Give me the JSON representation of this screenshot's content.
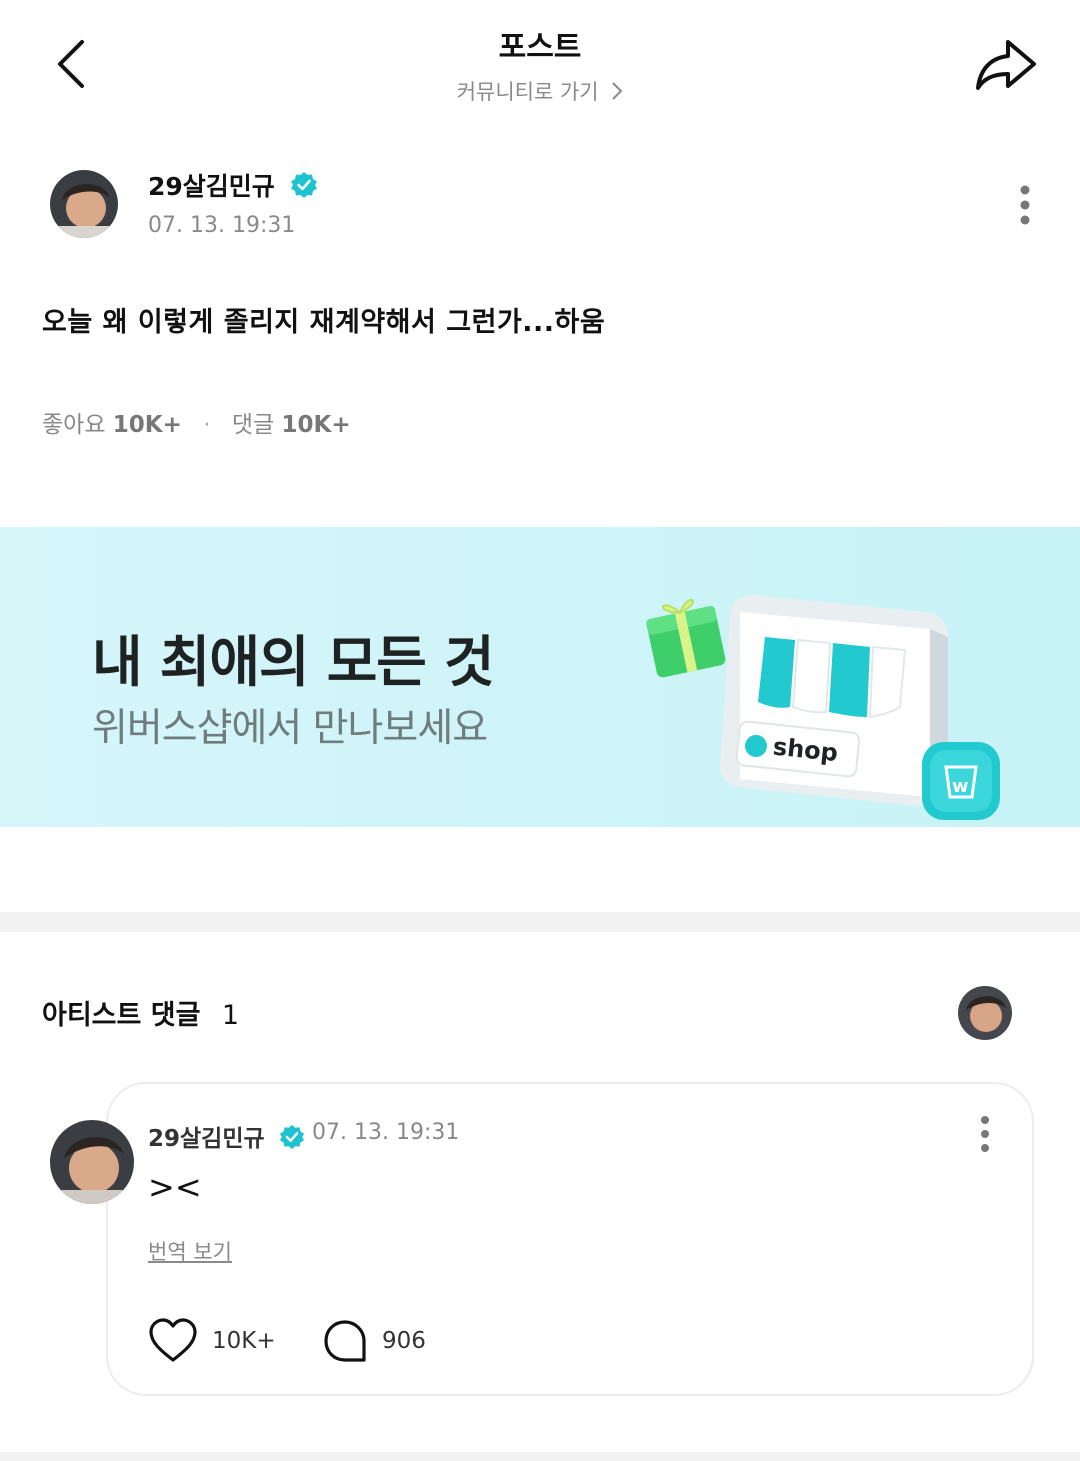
{
  "header": {
    "title": "포스트",
    "community_link": "커뮤니티로 가기"
  },
  "post": {
    "author": "29살김민규",
    "timestamp": "07. 13. 19:31",
    "body": "오늘 왜 이렇게 졸리지 재계약해서 그런가...하움",
    "likes_label": "좋아요",
    "likes_count": "10K+",
    "comments_label": "댓글",
    "comments_count": "10K+"
  },
  "banner": {
    "title": "내 최애의 모든 것",
    "subtitle": "위버스샵에서 만나보세요",
    "shop_label": "shop",
    "bag_glyph": "w"
  },
  "artist_comments": {
    "title": "아티스트 댓글",
    "count": "1",
    "items": [
      {
        "author": "29살김민규",
        "timestamp": "07. 13. 19:31",
        "text": "><",
        "translate_label": "번역 보기",
        "likes": "10K+",
        "replies": "906"
      }
    ]
  },
  "colors": {
    "verified": "#1ec3d2",
    "banner_bg": "#d6f6fa",
    "accent_teal": "#22c9cf",
    "separator": "#f2f2f3",
    "muted_text": "#8a8a8a"
  },
  "icons": [
    "back-arrow-icon",
    "share-icon",
    "chevron-right-icon",
    "verified-badge-icon",
    "more-vertical-icon",
    "heart-icon",
    "speech-bubble-icon",
    "gift-icon",
    "shopping-bag-icon"
  ]
}
